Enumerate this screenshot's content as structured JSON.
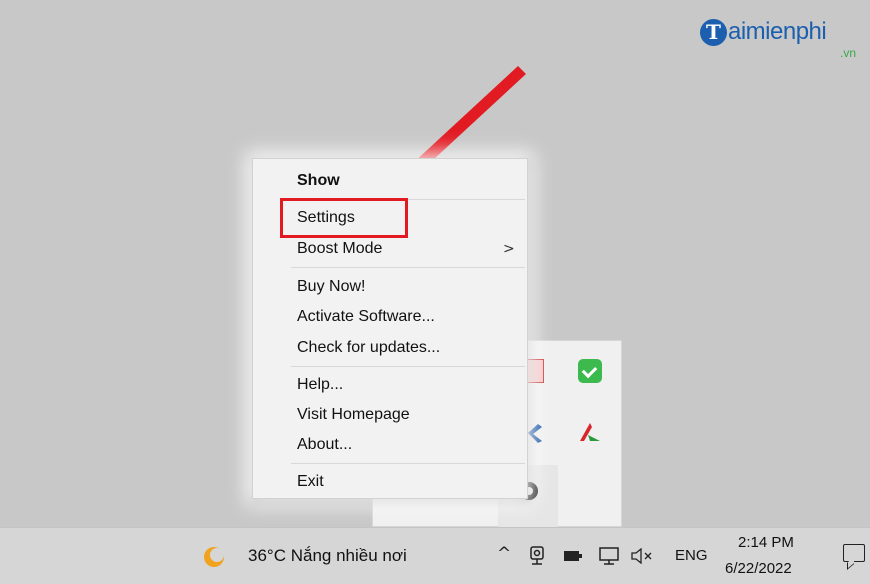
{
  "logo": {
    "initial": "T",
    "text": "aimienphi",
    "sub": ".vn"
  },
  "menu": {
    "items": [
      {
        "label": "Show"
      },
      {
        "label": "Settings"
      },
      {
        "label": "Boost Mode",
        "submenu": ">"
      },
      {
        "label": "Buy Now!"
      },
      {
        "label": "Activate Software..."
      },
      {
        "label": "Check for updates..."
      },
      {
        "label": "Help..."
      },
      {
        "label": "Visit Homepage"
      },
      {
        "label": "About..."
      },
      {
        "label": "Exit"
      }
    ]
  },
  "annotation": {
    "color": "#e21b23"
  },
  "taskbar": {
    "weather": "36°C  Nắng nhiều nơi",
    "overflow_chevron": "^",
    "language": "ENG",
    "time": "2:14 PM",
    "date": "6/22/2022",
    "icons": [
      "weather-sun-cloud-icon",
      "chevron-up-icon",
      "webcam-icon",
      "battery-icon",
      "network-icon",
      "volume-muted-icon",
      "notification-icon"
    ]
  }
}
